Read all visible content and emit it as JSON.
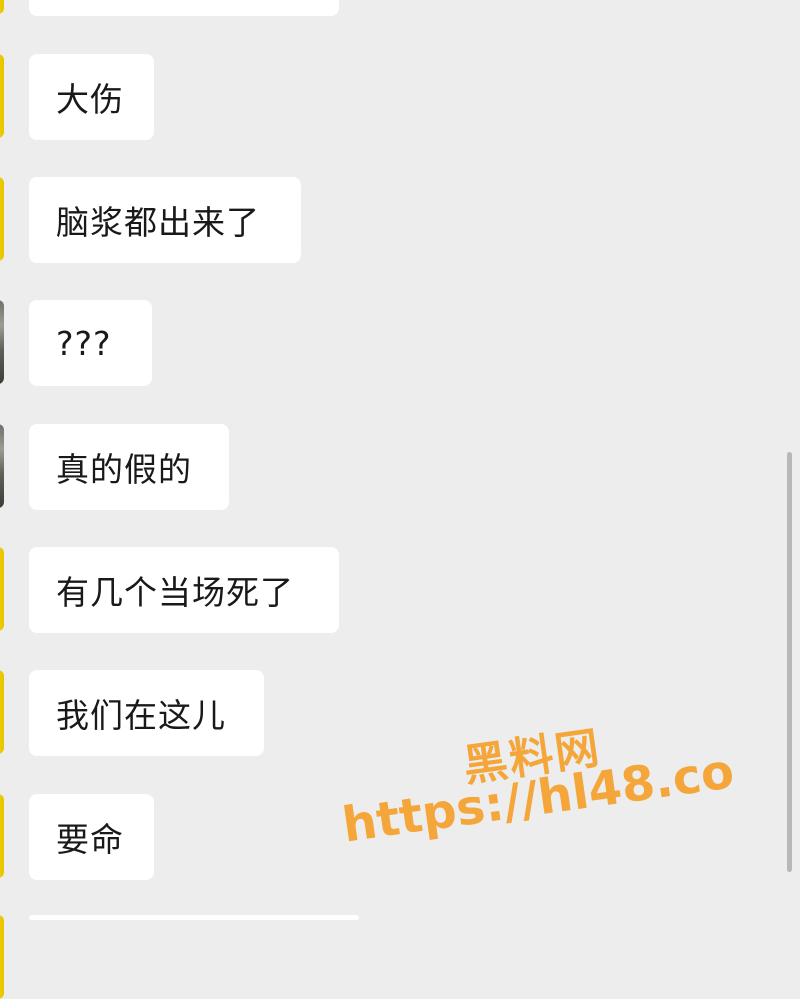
{
  "messages": [
    {
      "text": "",
      "avatar": "yellow"
    },
    {
      "text": "大伤",
      "avatar": "yellow"
    },
    {
      "text": "脑浆都出来了",
      "avatar": "yellow"
    },
    {
      "text": "???",
      "avatar": "gray"
    },
    {
      "text": "真的假的",
      "avatar": "gray"
    },
    {
      "text": "有几个当场死了",
      "avatar": "yellow"
    },
    {
      "text": "我们在这儿",
      "avatar": "yellow"
    },
    {
      "text": "要命",
      "avatar": "yellow"
    },
    {
      "text": "",
      "avatar": "yellow"
    }
  ],
  "watermark": {
    "title": "黑料网",
    "url": "https://hl48.co"
  },
  "colors": {
    "background": "#ededed",
    "bubble": "#ffffff",
    "watermark": "#f4a63a"
  }
}
